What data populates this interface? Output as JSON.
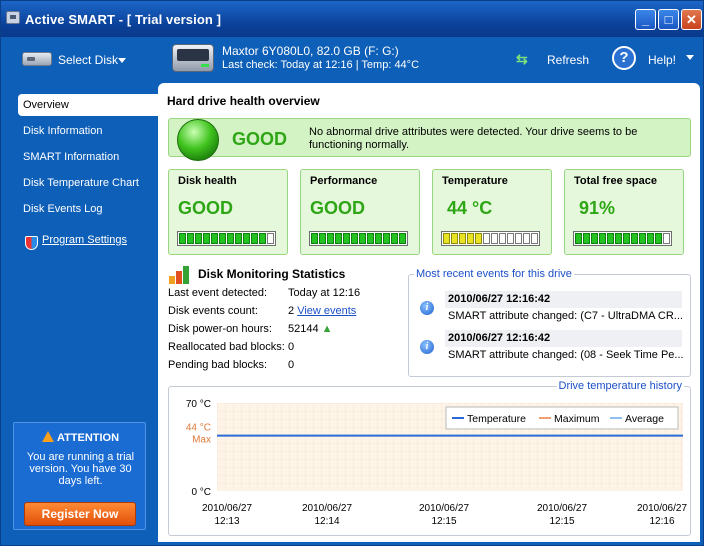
{
  "window": {
    "title": "Active SMART - [ Trial version ]",
    "buttons": {
      "minimize": "_",
      "maximize": "□",
      "close": "✕"
    }
  },
  "toolbar": {
    "select_disk": "Select Disk",
    "disk_title": "Maxtor 6Y080L0, 82.0 GB (F: G:)",
    "disk_subtitle": "Last check: Today at 12:16 | Temp: 44°C",
    "refresh": "Refresh",
    "help": "Help!",
    "help_glyph": "?"
  },
  "sidebar": {
    "items": [
      {
        "label": "Overview",
        "active": true
      },
      {
        "label": "Disk Information"
      },
      {
        "label": "SMART Information"
      },
      {
        "label": "Disk Temperature Chart"
      },
      {
        "label": "Disk Events Log"
      }
    ],
    "program_settings": "Program Settings",
    "attention": {
      "title": "ATTENTION",
      "text": "You are running a trial version. You have 30 days left.",
      "register": "Register Now"
    }
  },
  "main": {
    "title": "Hard drive health overview",
    "status_word": "GOOD",
    "status_text": "No abnormal drive attributes were detected. Your drive seems to be functioning normally.",
    "cards": [
      {
        "title": "Disk health",
        "value": "GOOD",
        "level": 0.9,
        "color": "green"
      },
      {
        "title": "Performance",
        "value": "GOOD",
        "level": 1.0,
        "color": "green"
      },
      {
        "title": "Temperature",
        "value": "44 °C",
        "level": 0.4,
        "color": "yellow"
      },
      {
        "title": "Total free space",
        "value": "91%",
        "level": 0.9,
        "color": "green"
      }
    ],
    "stats": {
      "title": "Disk Monitoring Statistics",
      "rows": [
        {
          "label": "Last event detected:",
          "value": "Today at 12:16"
        },
        {
          "label": "Disk events count:",
          "value": "2",
          "link": "View events"
        },
        {
          "label": "Disk power-on hours:",
          "value": "52144"
        },
        {
          "label": "Reallocated bad blocks:",
          "value": "0"
        },
        {
          "label": "Pending bad blocks:",
          "value": "0"
        }
      ]
    },
    "events": {
      "title": "Most recent events for this drive",
      "items": [
        {
          "time": "2010/06/27 12:16:42",
          "desc": "SMART attribute changed: (C7 - UltraDMA CR..."
        },
        {
          "time": "2010/06/27 12:16:42",
          "desc": "SMART attribute changed: (08 - Seek Time Pe..."
        }
      ]
    }
  },
  "colors": {
    "window_blue": "#0d5fb8",
    "good_green": "#2ea616",
    "link_blue": "#1b4fc8",
    "temperature_line": "#2a6ad8",
    "maximum_line": "#f0a070",
    "average_line": "#8fc0f0"
  },
  "chart_data": {
    "type": "line",
    "title": "Drive temperature history",
    "ylim": [
      0,
      70
    ],
    "y_ticks": [
      "70 °C",
      "0 °C"
    ],
    "max_marker": {
      "value": 44,
      "labels": [
        "44 °C",
        "Max"
      ]
    },
    "categories": [
      "2010/06/27 12:13",
      "2010/06/27 12:14",
      "2010/06/27 12:15",
      "2010/06/27 12:15",
      "2010/06/27 12:16"
    ],
    "x_tick_dates": [
      "2010/06/27",
      "2010/06/27",
      "2010/06/27",
      "2010/06/27",
      "2010/06/27"
    ],
    "x_tick_times": [
      "12:13",
      "12:14",
      "12:15",
      "12:15",
      "12:16"
    ],
    "series": [
      {
        "name": "Temperature",
        "values": [
          44,
          44,
          44,
          44,
          44
        ]
      },
      {
        "name": "Maximum",
        "values": []
      },
      {
        "name": "Average",
        "values": []
      }
    ],
    "legend": "top-right",
    "grid": true
  }
}
